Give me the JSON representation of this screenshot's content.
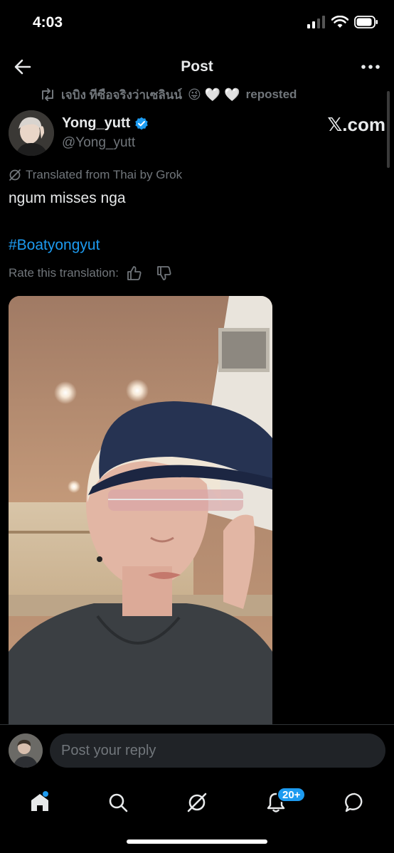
{
  "status_bar": {
    "time": "4:03"
  },
  "nav": {
    "title": "Post"
  },
  "repost": {
    "name": "เจบิง ทีซือจริงว่าเซลินน์",
    "emojis": "😜 🤍 🤍",
    "label": "reposted"
  },
  "author": {
    "display_name": "Yong_yutt",
    "handle": "@Yong_yutt",
    "verified": true
  },
  "watermark": "𝕏.com",
  "post": {
    "translation_note": "Translated from Thai by Grok",
    "text": "ngum misses nga",
    "hashtag": "#Boatyongyut",
    "rate_label": "Rate this translation:"
  },
  "reply": {
    "placeholder": "Post your reply"
  },
  "tabs": {
    "home": "home-icon",
    "search": "search-icon",
    "grok": "grok-icon",
    "notifications": "bell-icon",
    "messages": "messages-icon",
    "notifications_badge": "20+"
  },
  "colors": {
    "accent": "#1d9bf0",
    "background": "#000000",
    "secondary_text": "#71767b"
  }
}
